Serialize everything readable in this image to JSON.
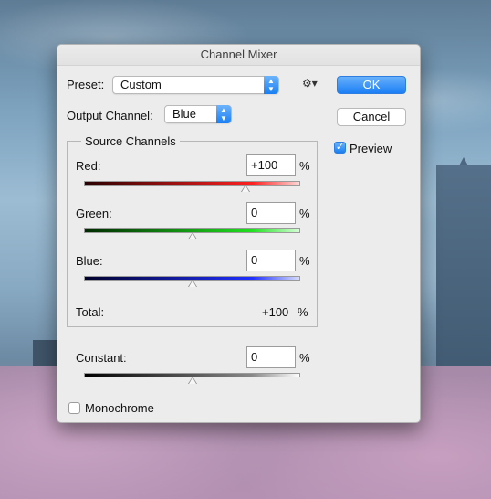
{
  "dialog": {
    "title": "Channel Mixer"
  },
  "preset": {
    "label": "Preset:",
    "value": "Custom",
    "gear_glyph": "⚙▾"
  },
  "output": {
    "label": "Output Channel:",
    "value": "Blue"
  },
  "buttons": {
    "ok": "OK",
    "cancel": "Cancel"
  },
  "preview": {
    "label": "Preview",
    "checked": true,
    "check_glyph": "✓"
  },
  "source": {
    "title": "Source Channels",
    "channels": [
      {
        "name": "Red:",
        "value": "+100",
        "unit": "%",
        "percent": 100,
        "track_colors": [
          "#2a0000",
          "#ff2020",
          "#ffd6d6"
        ]
      },
      {
        "name": "Green:",
        "value": "0",
        "unit": "%",
        "percent": 0,
        "track_colors": [
          "#002a00",
          "#20e020",
          "#d6ffd6"
        ]
      },
      {
        "name": "Blue:",
        "value": "0",
        "unit": "%",
        "percent": 0,
        "track_colors": [
          "#00002a",
          "#2030ff",
          "#d6dcff"
        ]
      }
    ],
    "total_label": "Total:",
    "total_value": "+100",
    "total_unit": "%"
  },
  "constant": {
    "label": "Constant:",
    "value": "0",
    "unit": "%",
    "percent": 0,
    "track_colors": [
      "#000000",
      "#888888",
      "#ffffff"
    ]
  },
  "monochrome": {
    "label": "Monochrome",
    "checked": false
  },
  "stepper_glyph": {
    "up": "▲",
    "down": "▼"
  }
}
